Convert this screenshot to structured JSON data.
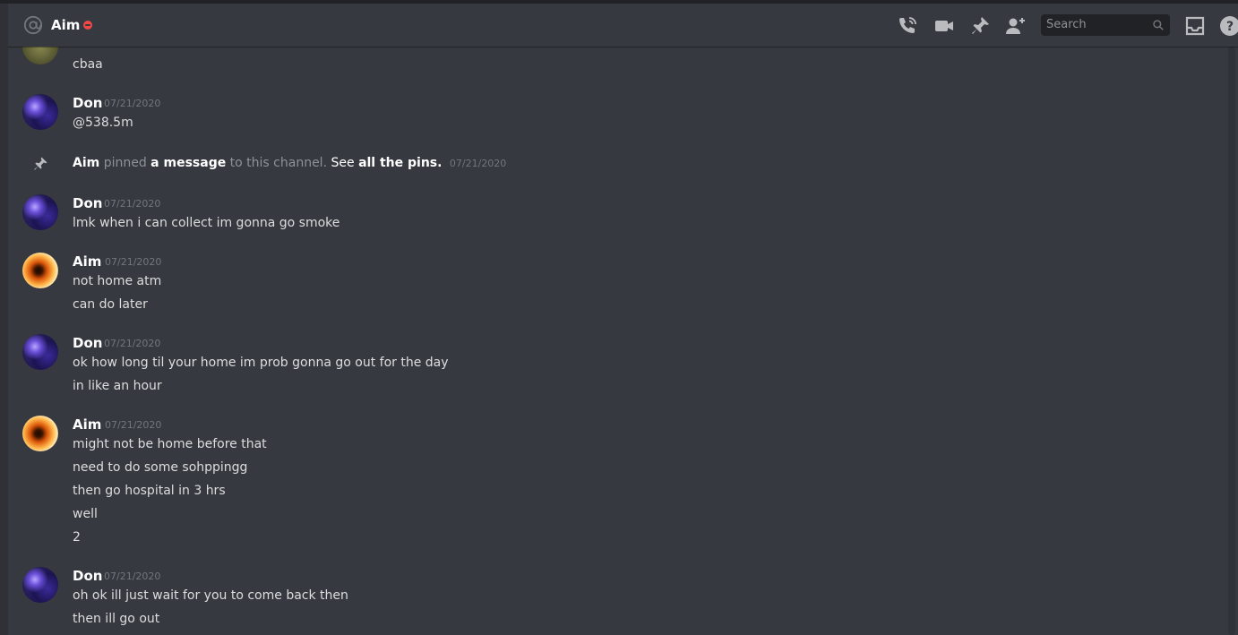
{
  "header": {
    "channel_icon": "at-sign-icon",
    "title": "Aim",
    "status": "do-not-disturb",
    "status_color": "#f04747",
    "search_placeholder": "Search",
    "icons": [
      "phone-call-icon",
      "video-call-icon",
      "pin-icon",
      "add-friend-icon",
      "search-icon",
      "inbox-icon",
      "help-icon"
    ]
  },
  "colors": {
    "background": "#36393f",
    "author": "#ffffff",
    "text": "#dcddde",
    "timestamp": "#72767d"
  },
  "messages": {
    "m0": {
      "lines": [
        "cbaa"
      ]
    },
    "m1": {
      "author": "Don",
      "timestamp": "07/21/2020",
      "lines": [
        "@538.5m"
      ]
    },
    "pin_notice": {
      "actor": "Aim",
      "text1": "pinned",
      "link1": "a message",
      "text2": "to this channel.",
      "link2_prefix": "See",
      "link2": "all the pins.",
      "timestamp": "07/21/2020"
    },
    "m2": {
      "author": "Don",
      "timestamp": "07/21/2020",
      "lines": [
        "lmk when i can collect im gonna go smoke"
      ]
    },
    "m3": {
      "author": "Aim",
      "timestamp": "07/21/2020",
      "lines": [
        "not home atm",
        "can do later"
      ]
    },
    "m4": {
      "author": "Don",
      "timestamp": "07/21/2020",
      "lines": [
        "ok how long til your home im prob gonna go out for the day",
        "in like an hour"
      ]
    },
    "m5": {
      "author": "Aim",
      "timestamp": "07/21/2020",
      "lines": [
        "might not be home before that",
        "need to do some sohppingg",
        "then go hospital in 3 hrs",
        "well",
        "2"
      ]
    },
    "m6": {
      "author": "Don",
      "timestamp": "07/21/2020",
      "lines": [
        "oh ok ill just wait for you to come back then",
        "then ill go out"
      ]
    }
  }
}
